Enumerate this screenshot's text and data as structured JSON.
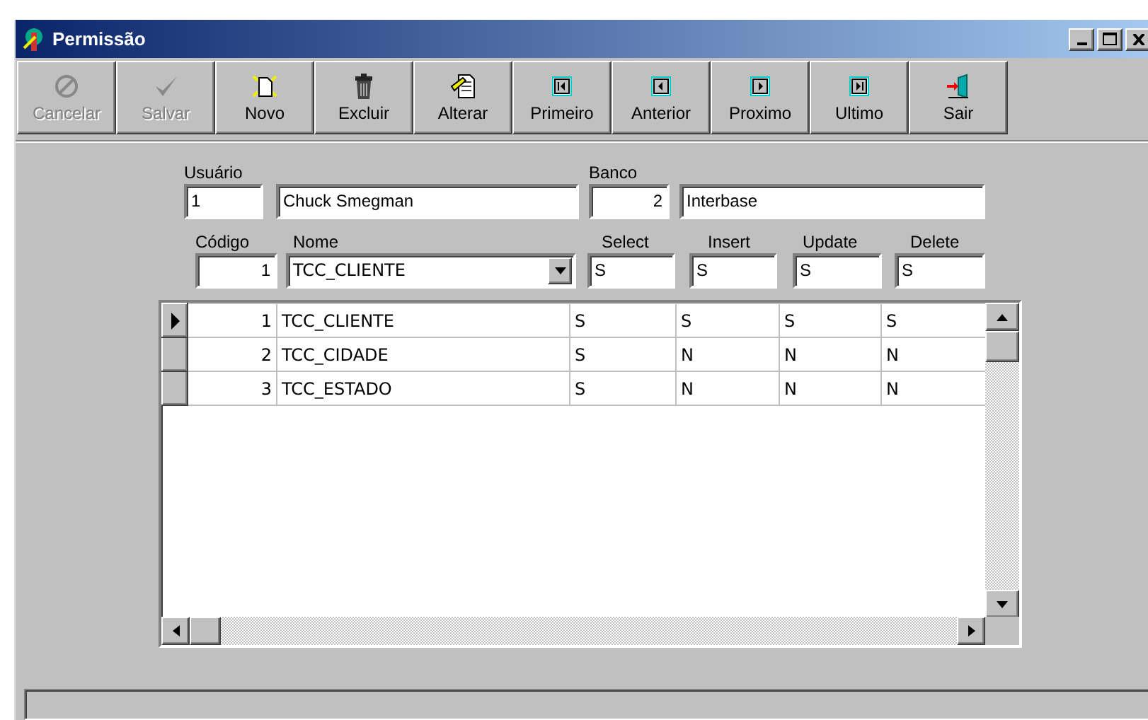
{
  "window": {
    "title": "Permissão"
  },
  "toolbar": [
    {
      "kind": "cancel",
      "label": "Cancelar",
      "disabled": true
    },
    {
      "kind": "save",
      "label": "Salvar",
      "disabled": true
    },
    {
      "kind": "new",
      "label": "Novo",
      "disabled": false
    },
    {
      "kind": "delete",
      "label": "Excluir",
      "disabled": false
    },
    {
      "kind": "edit",
      "label": "Alterar",
      "disabled": false
    },
    {
      "kind": "first",
      "label": "Primeiro",
      "disabled": false
    },
    {
      "kind": "prior",
      "label": "Anterior",
      "disabled": false
    },
    {
      "kind": "next",
      "label": "Proximo",
      "disabled": false
    },
    {
      "kind": "last",
      "label": "Ultimo",
      "disabled": false
    },
    {
      "kind": "exit",
      "label": "Sair",
      "disabled": false
    }
  ],
  "user": {
    "label": "Usuário",
    "id": "1",
    "name": "Chuck Smegman"
  },
  "bank": {
    "label": "Banco",
    "id": "2",
    "name": "Interbase"
  },
  "permission": [
    {
      "kind": "number",
      "label": "Código",
      "value": "1"
    },
    {
      "kind": "combo",
      "label": "Nome",
      "value": "TCC_CLIENTE"
    },
    {
      "kind": "text",
      "label": "Select",
      "value": "S"
    },
    {
      "kind": "text",
      "label": "Insert",
      "value": "S"
    },
    {
      "kind": "text",
      "label": "Update",
      "value": "S"
    },
    {
      "kind": "text",
      "label": "Delete",
      "value": "S"
    }
  ],
  "grid": {
    "rows": [
      {
        "selected": true,
        "cells": [
          "1",
          "TCC_CLIENTE",
          "S",
          "S",
          "S",
          "S"
        ]
      },
      {
        "selected": false,
        "cells": [
          "2",
          "TCC_CIDADE",
          "S",
          "N",
          "N",
          "N"
        ]
      },
      {
        "selected": false,
        "cells": [
          "3",
          "TCC_ESTADO",
          "S",
          "N",
          "N",
          "N"
        ]
      }
    ]
  }
}
